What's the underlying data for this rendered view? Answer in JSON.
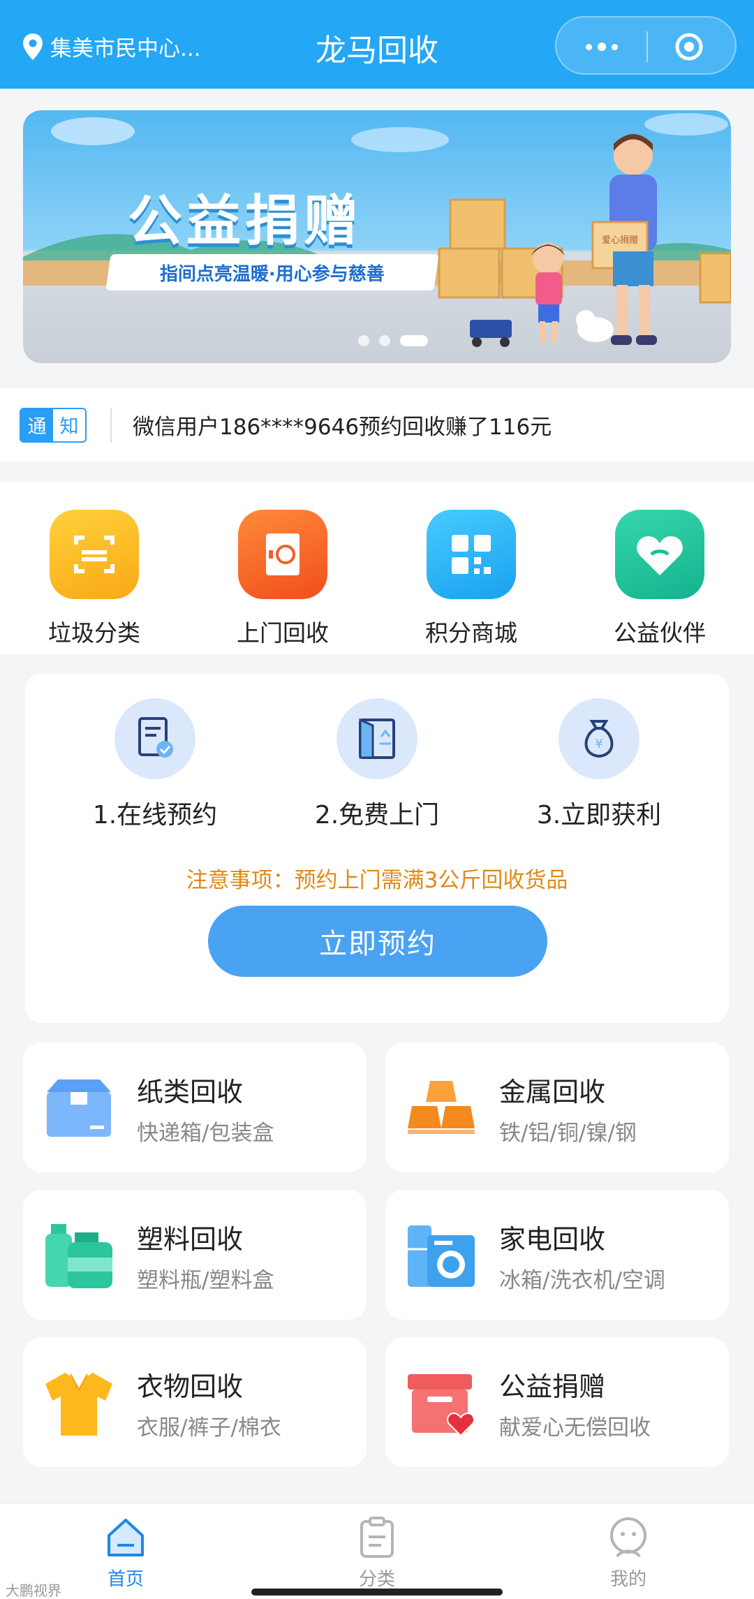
{
  "header": {
    "location": "集美市民中心...",
    "title": "龙马回收"
  },
  "banner": {
    "title": "公益捐赠",
    "subtitle": "指间点亮温暖·用心参与慈善",
    "box_label": "爱心捐赠",
    "active_slide": 3,
    "slide_count": 3
  },
  "notice": {
    "tag_1": "通",
    "tag_2": "知",
    "text": "微信用户186****9646预约回收赚了116元"
  },
  "grid_nav": [
    {
      "label": "垃圾分类",
      "icon": "scan-icon",
      "color": "#fbb41f"
    },
    {
      "label": "上门回收",
      "icon": "recycle-door-icon",
      "color": "#f5661e"
    },
    {
      "label": "积分商城",
      "icon": "qr-icon",
      "color": "#2fb4f2"
    },
    {
      "label": "公益伙伴",
      "icon": "heart-icon",
      "color": "#22c39c"
    }
  ],
  "steps": {
    "items": [
      {
        "label": "1.在线预约",
        "icon": "document-check-icon"
      },
      {
        "label": "2.免费上门",
        "icon": "door-recycle-icon"
      },
      {
        "label": "3.立即获利",
        "icon": "money-bag-icon"
      }
    ],
    "note": "注意事项：预约上门需满3公斤回收货品",
    "button": "立即预约"
  },
  "categories": [
    {
      "title": "纸类回收",
      "sub": "快递箱/包装盒",
      "icon": "box-icon"
    },
    {
      "title": "金属回收",
      "sub": "铁/铝/铜/镍/钢",
      "icon": "metal-ingot-icon"
    },
    {
      "title": "塑料回收",
      "sub": "塑料瓶/塑料盒",
      "icon": "plastic-bottle-icon"
    },
    {
      "title": "家电回收",
      "sub": "冰箱/洗衣机/空调",
      "icon": "appliance-icon"
    },
    {
      "title": "衣物回收",
      "sub": "衣服/裤子/棉衣",
      "icon": "shirt-icon"
    },
    {
      "title": "公益捐赠",
      "sub": "献爱心无偿回收",
      "icon": "donation-box-icon"
    }
  ],
  "tabbar": [
    {
      "label": "首页",
      "icon": "home-icon",
      "active": true
    },
    {
      "label": "分类",
      "icon": "clipboard-icon",
      "active": false
    },
    {
      "label": "我的",
      "icon": "user-icon",
      "active": false
    }
  ],
  "watermark": "大鹏视界"
}
